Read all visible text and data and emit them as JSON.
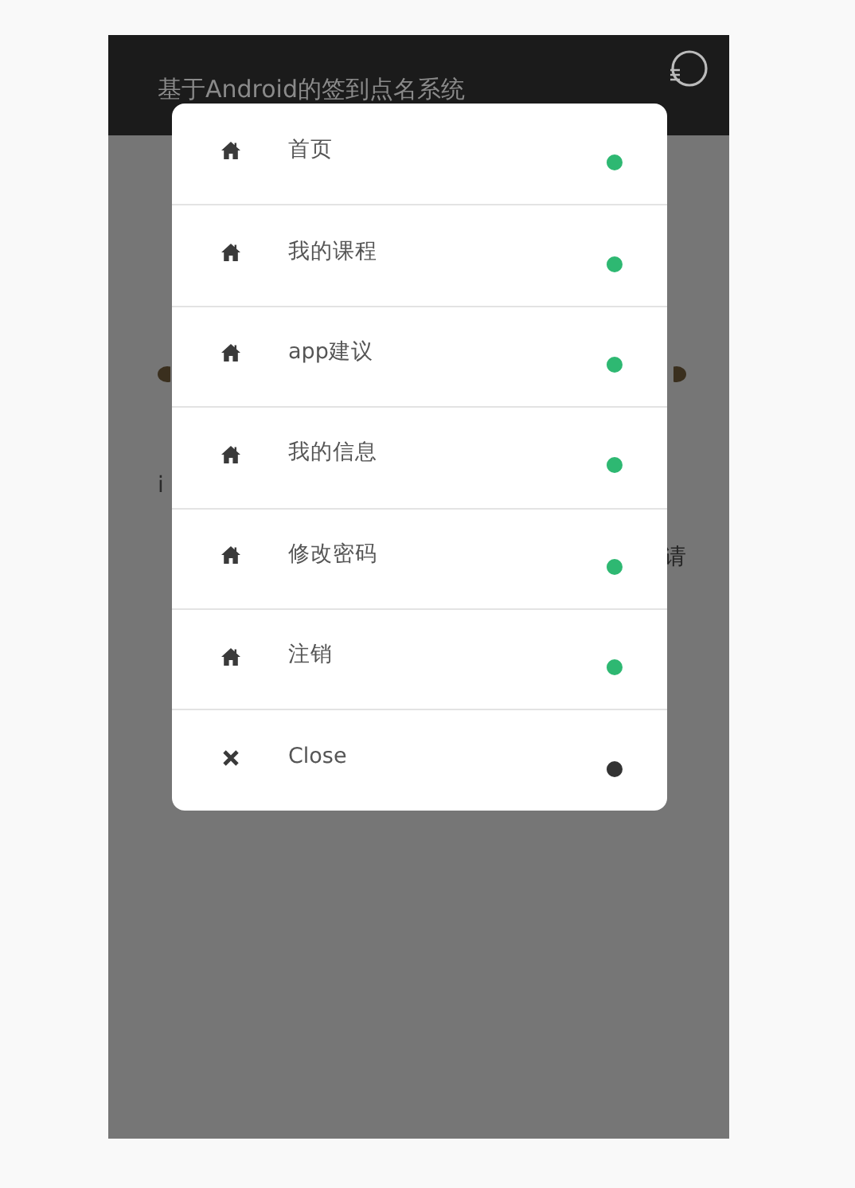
{
  "app_bar": {
    "title": "基于Android的签到点名系统"
  },
  "background": {
    "left_text": "i",
    "right_text": "请"
  },
  "menu": {
    "items": [
      {
        "label": "首页",
        "kind": "home",
        "color": "#2eb872"
      },
      {
        "label": "我的课程",
        "kind": "home",
        "color": "#2eb872"
      },
      {
        "label": "app建议",
        "kind": "home",
        "color": "#2eb872"
      },
      {
        "label": "我的信息",
        "kind": "home",
        "color": "#2eb872"
      },
      {
        "label": "修改密码",
        "kind": "home",
        "color": "#2eb872"
      },
      {
        "label": "注销",
        "kind": "home",
        "color": "#2eb872"
      },
      {
        "label": "Close",
        "kind": "close",
        "color": "#333333"
      }
    ]
  }
}
